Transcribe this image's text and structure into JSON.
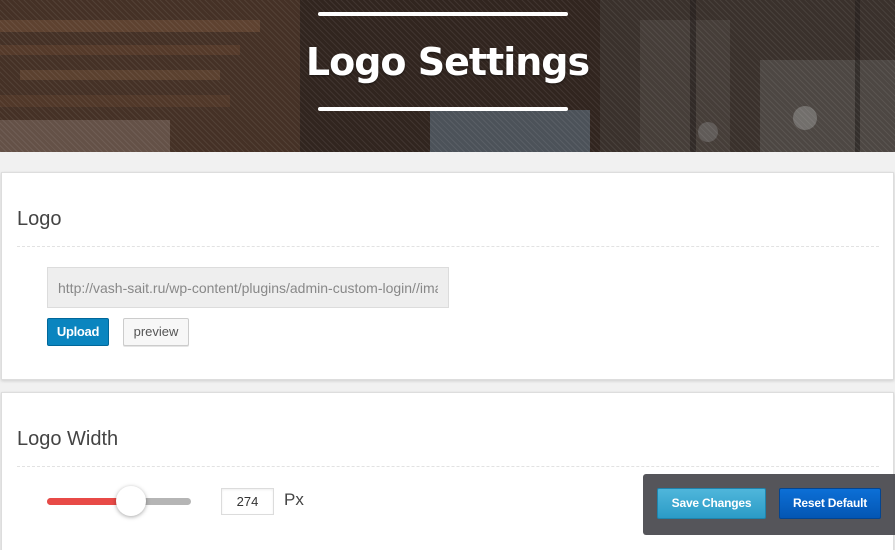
{
  "header": {
    "title": "Logo Settings"
  },
  "logo_section": {
    "title": "Logo",
    "url_value": "http://vash-sait.ru/wp-content/plugins/admin-custom-login//images/wordpress-logo.png",
    "upload_label": "Upload",
    "preview_label": "preview"
  },
  "logo_width_section": {
    "title": "Logo Width",
    "width_value": "274",
    "unit": "Px",
    "slider_fraction": 0.58
  },
  "actions": {
    "save_label": "Save Changes",
    "reset_label": "Reset Default"
  },
  "colors": {
    "upload_button": "#0a85bf",
    "slider_fill": "#e84a47",
    "save_button": "#2b9bc6",
    "reset_button": "#0456b3"
  }
}
